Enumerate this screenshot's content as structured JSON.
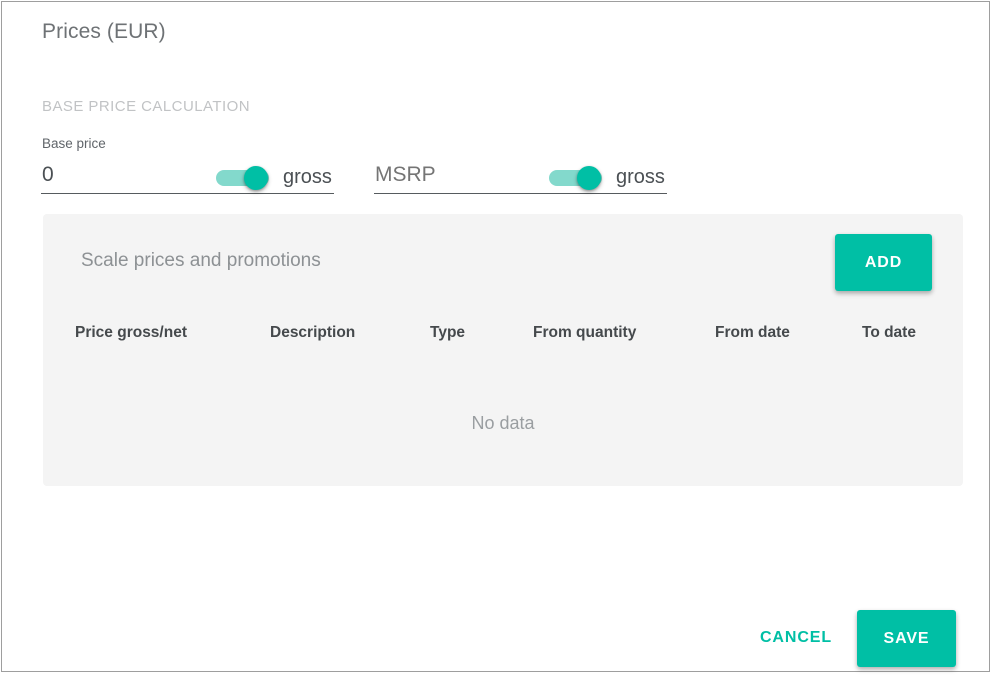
{
  "page": {
    "title": "Prices (EUR)",
    "section_label": "BASE PRICE CALCULATION"
  },
  "fields": {
    "base_price": {
      "label": "Base price",
      "value": "0",
      "placeholder": "Base price",
      "toggle_caption": "gross",
      "toggle_on": true
    },
    "msrp": {
      "label": "",
      "value": "",
      "placeholder": "MSRP",
      "toggle_caption": "gross",
      "toggle_on": true
    }
  },
  "scale_panel": {
    "title": "Scale prices and promotions",
    "add_label": "ADD",
    "columns": [
      "Price gross/net",
      "Description",
      "Type",
      "From quantity",
      "From date",
      "To date"
    ],
    "empty_text": "No data",
    "rows": []
  },
  "footer": {
    "cancel_label": "CANCEL",
    "save_label": "SAVE"
  },
  "colors": {
    "accent": "#00bfa5",
    "toggle_track": "#83d9cc",
    "panel_bg": "#f4f4f4",
    "title_text": "#6e7275",
    "muted_text": "#9a9ea1",
    "section_label": "#c1c3c5",
    "border": "#9e9e9e"
  }
}
